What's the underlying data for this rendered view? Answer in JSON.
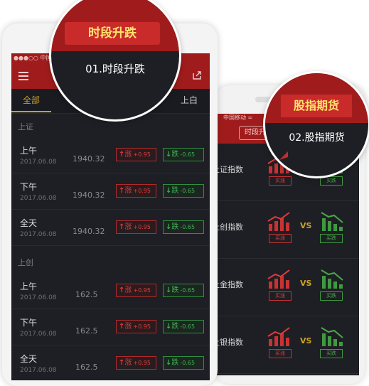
{
  "colors": {
    "brand_red": "#a01c1c",
    "callout_red": "#c92a2a",
    "highlight_yellow": "#ffe36b",
    "accent_gold": "#c9a227",
    "up_red": "#e33a3a",
    "down_green": "#3fb053",
    "screen_bg": "#1e1f24"
  },
  "front_phone": {
    "status_carrier": "●●●○○ 中国移",
    "nav": {
      "menu_icon": "menu-icon",
      "share_icon": "share-icon"
    },
    "tabs": {
      "all": "全部",
      "right": "上白"
    },
    "sections": [
      {
        "title": "上证",
        "rows": [
          {
            "label": "上午",
            "date": "2017.06.08",
            "value": "1940.32",
            "up_arrow": "↑",
            "up_label": "涨",
            "up_delta": "+0.95",
            "down_arrow": "↓",
            "down_label": "跌",
            "down_delta": "-0.65"
          },
          {
            "label": "下午",
            "date": "2017.06.08",
            "value": "1940.32",
            "up_arrow": "↑",
            "up_label": "涨",
            "up_delta": "+0.95",
            "down_arrow": "↓",
            "down_label": "跌",
            "down_delta": "-0.65"
          },
          {
            "label": "全天",
            "date": "2017.06.08",
            "value": "1940.32",
            "up_arrow": "↑",
            "up_label": "涨",
            "up_delta": "+0.95",
            "down_arrow": "↓",
            "down_label": "跌",
            "down_delta": "-0.65"
          }
        ]
      },
      {
        "title": "上创",
        "rows": [
          {
            "label": "上午",
            "date": "2017.06.08",
            "value": "162.5",
            "up_arrow": "↑",
            "up_label": "涨",
            "up_delta": "+0.95",
            "down_arrow": "↓",
            "down_label": "跌",
            "down_delta": "-0.65"
          },
          {
            "label": "下午",
            "date": "2017.06.08",
            "value": "162.5",
            "up_arrow": "↑",
            "up_label": "涨",
            "up_delta": "+0.95",
            "down_arrow": "↓",
            "down_label": "跌",
            "down_delta": "-0.65"
          },
          {
            "label": "全天",
            "date": "2017.06.08",
            "value": "162.5",
            "up_arrow": "↑",
            "up_label": "涨",
            "up_delta": "+0.95",
            "down_arrow": "↓",
            "down_label": "跌",
            "down_delta": "-0.65"
          }
        ]
      }
    ]
  },
  "back_phone": {
    "status_carrier": "中国移动 ≈",
    "tab_pill": "时段升",
    "rows": [
      {
        "name": "上证指数",
        "buy_up": "买涨",
        "vs": "",
        "buy_down": "买跌"
      },
      {
        "name": "上创指数",
        "buy_up": "买涨",
        "vs": "VS",
        "buy_down": "买跌"
      },
      {
        "name": "上金指数",
        "buy_up": "买涨",
        "vs": "VS",
        "buy_down": "买跌"
      },
      {
        "name": "上银指数",
        "buy_up": "买涨",
        "vs": "VS",
        "buy_down": "买跌"
      }
    ]
  },
  "callouts": [
    {
      "pill": "时段升跌",
      "caption": "01.时段升跌"
    },
    {
      "pill": "股指期货",
      "caption": "02.股指期货"
    }
  ]
}
